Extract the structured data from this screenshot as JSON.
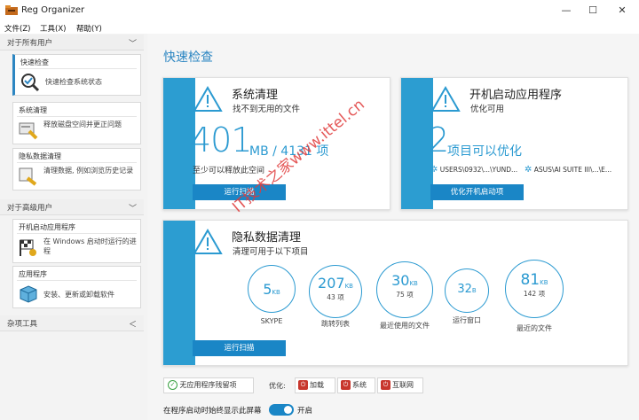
{
  "window": {
    "title": "Reg Organizer",
    "min": "—",
    "max": "☐",
    "close": "✕"
  },
  "menu": [
    "文件(Z)",
    "工具(X)",
    "帮助(Y)"
  ],
  "sidebar": {
    "section_all": "对于所有用户",
    "section_advanced": "对于高级用户",
    "section_misc": "杂项工具",
    "cards": [
      {
        "title": "快速检查",
        "desc": "快速检查系统状态",
        "icon": "check-magnifier-icon"
      },
      {
        "title": "系统清理",
        "desc": "释放磁盘空间并更正问题",
        "icon": "cleanup-icon"
      },
      {
        "title": "隐私数据清理",
        "desc": "清理数据, 例如浏览历史记录",
        "icon": "privacy-brush-icon"
      },
      {
        "title": "开机启动应用程序",
        "desc": "在 Windows 启动时运行的进程",
        "icon": "startup-flag-icon"
      },
      {
        "title": "应用程序",
        "desc": "安装、更新或卸载软件",
        "icon": "package-icon"
      }
    ]
  },
  "main": {
    "title": "快速检查",
    "cleanup": {
      "title": "系统清理",
      "subtitle": "找不到无用的文件",
      "value": "401",
      "unit_text": "MB / 4131 项",
      "note": "至少可以释放此空间",
      "button": "运行扫描"
    },
    "startup": {
      "title": "开机启动应用程序",
      "subtitle": "优化可用",
      "value": "2",
      "value_text": "项目可以优化",
      "items": [
        "USERS\\0932\\...\\YUND...",
        "ASUS\\AI SUITE III\\...\\E..."
      ],
      "button": "优化开机启动项"
    },
    "privacy": {
      "title": "隐私数据清理",
      "subtitle": "清理可用于以下项目",
      "button": "运行扫描",
      "circles": [
        {
          "value": "5",
          "unit": "KB",
          "count": "",
          "label": "SKYPE"
        },
        {
          "value": "207",
          "unit": "KB",
          "count": "43 项",
          "label": "跳转列表"
        },
        {
          "value": "30",
          "unit": "KB",
          "count": "75 项",
          "label": "最近使用的文件"
        },
        {
          "value": "32",
          "unit": "B",
          "count": "",
          "label": "运行窗口"
        },
        {
          "value": "81",
          "unit": "KB",
          "count": "142 项",
          "label": "最近的文件"
        }
      ]
    },
    "bottom": {
      "leftover": "无应用程序残留项",
      "optimize_label": "优化:",
      "optimize_items": [
        "加载",
        "系统",
        "互联网"
      ],
      "toggle_label": "在程序启动时始终显示此屏幕",
      "toggle_state": "开启"
    }
  },
  "watermark": "IT技术之家www.ittel.cn",
  "colors": {
    "accent": "#2b9ad1",
    "button": "#1a86c6",
    "danger": "#c8372d"
  }
}
